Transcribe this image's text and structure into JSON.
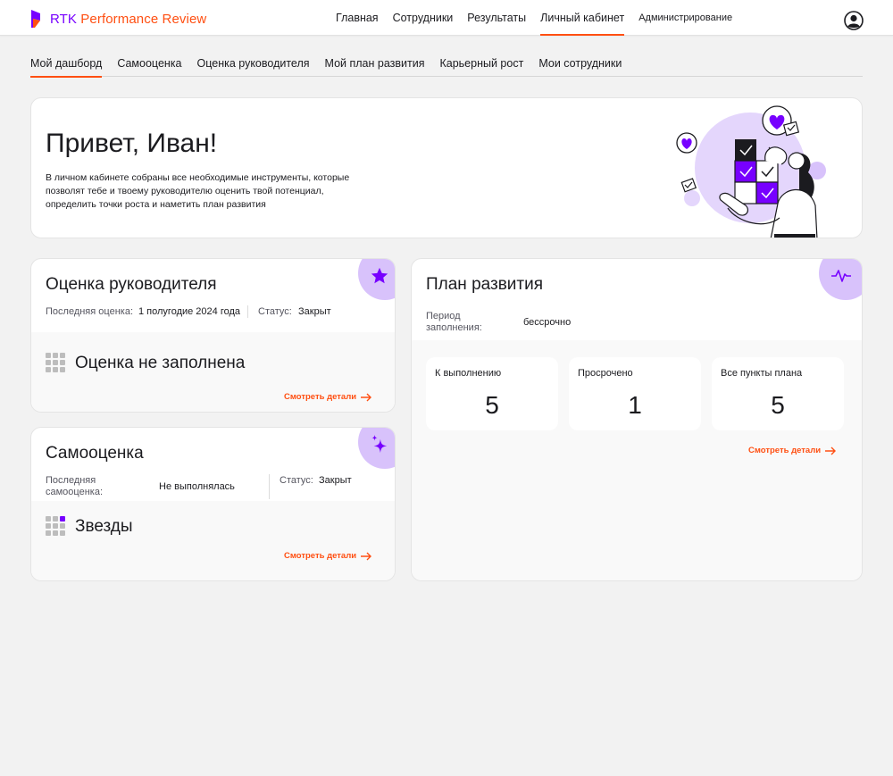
{
  "app": {
    "name_prefix": "RTK",
    "name_rest": " Performance Review"
  },
  "topnav": [
    {
      "label": "Главная"
    },
    {
      "label": "Сотрудники"
    },
    {
      "label": "Результаты"
    },
    {
      "label": "Личный кабинет",
      "active": true
    },
    {
      "label": "Администрирование"
    }
  ],
  "subtabs": [
    {
      "label": "Мой дашборд",
      "active": true
    },
    {
      "label": "Самооценка"
    },
    {
      "label": "Оценка руководителя"
    },
    {
      "label": "Мой план развития"
    },
    {
      "label": "Карьерный рост"
    },
    {
      "label": "Мои сотрудники"
    }
  ],
  "hero": {
    "title": "Привет, Иван!",
    "text": "В личном кабинете собраны все необходимые инструменты, которые позволят тебе и твоему руководителю оценить твой потенциал, определить точки роста и наметить план развития"
  },
  "manager_review": {
    "title": "Оценка руководителя",
    "last_label": "Последняя оценка:",
    "last_value": "1 полугодие 2024 года",
    "status_label": "Статус:",
    "status_value": "Закрыт",
    "result": "Оценка не заполнена",
    "details": "Смотреть детали",
    "icon": "star-icon"
  },
  "self_review": {
    "title": "Самооценка",
    "last_label": "Последняя самооценка:",
    "last_value": "Не выполнялась",
    "status_label": "Статус:",
    "status_value": "Закрыт",
    "result": "Звезды",
    "details": "Смотреть детали",
    "icon": "sparkles-icon"
  },
  "dev_plan": {
    "title": "План развития",
    "period_label": "Период заполнения:",
    "period_value": "бессрочно",
    "stats": [
      {
        "label": "К выполнению",
        "value": "5"
      },
      {
        "label": "Просрочено",
        "value": "1"
      },
      {
        "label": "Все пункты плана",
        "value": "5"
      }
    ],
    "details": "Смотреть детали",
    "icon": "pulse-icon"
  },
  "colors": {
    "accent": "#ff4f12",
    "brand": "#7700ff",
    "badge": "#d8c2fb"
  }
}
